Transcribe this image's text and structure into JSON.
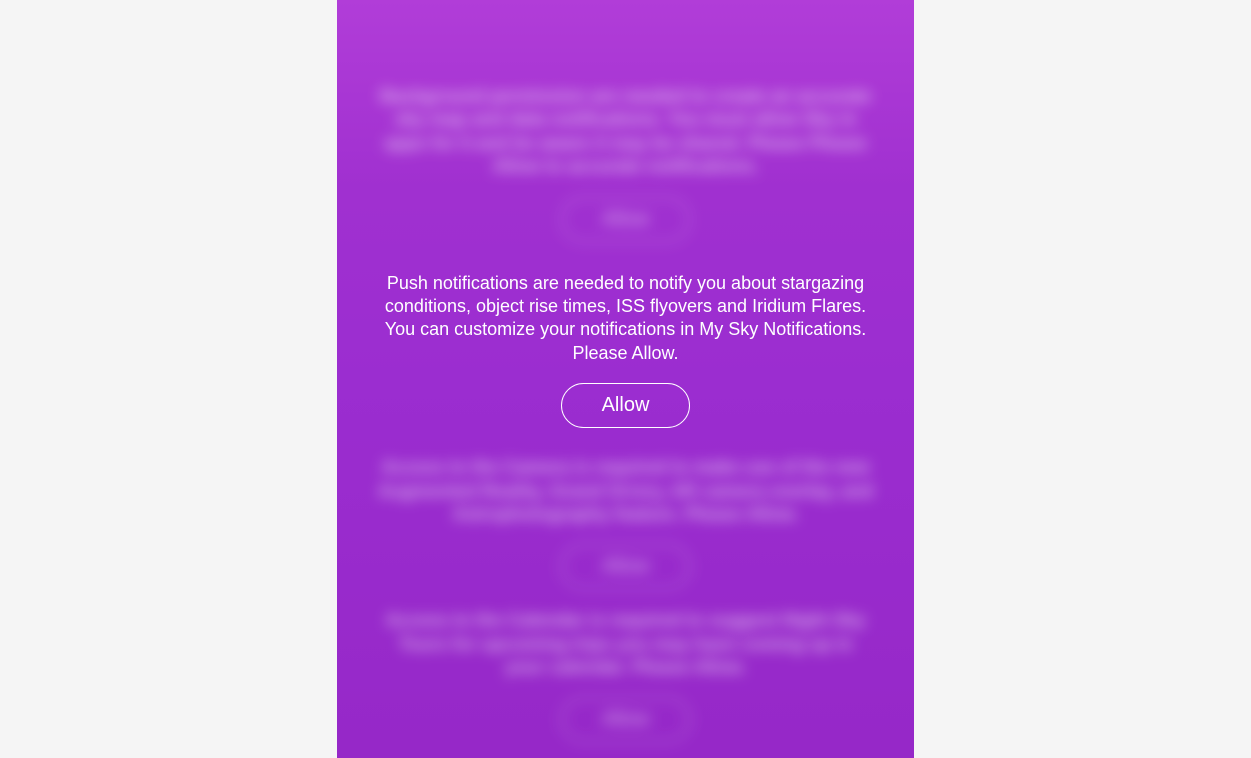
{
  "permissions": {
    "section1": {
      "text": "Background permission are needed to create an accurate sky map and data notifications. You must allow Sky in apps for it and be aware it may be shared. Please Please Allow to accurate notifications.",
      "button": "Allow"
    },
    "section2_active": {
      "text": "Push notifications are needed to notify you about stargazing conditions, object rise times, ISS flyovers and Iridium Flares. You can customize your notifications in My Sky Notifications. Please Allow.",
      "button": "Allow"
    },
    "section3": {
      "text": "Access to the Camera is required to make use of the new Augmented Reality, Grand Orrery, AR camera overlay, and Astrophotography feature. Please Allow.",
      "button": "Allow"
    },
    "section4": {
      "text": "Access to the Calendar is required to suggest Night Sky Tours for upcoming trips you may have coming up in your calendar. Please Allow.",
      "button": "Allow"
    }
  }
}
